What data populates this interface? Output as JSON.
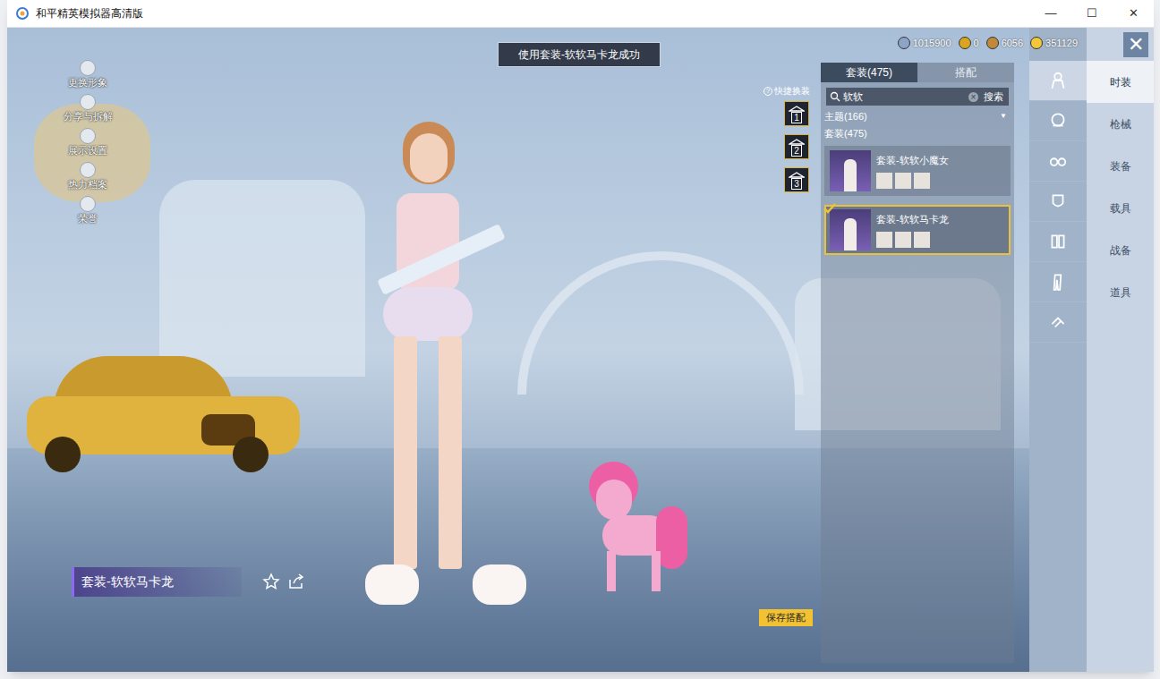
{
  "window": {
    "title": "和平精英模拟器高清版",
    "controls": [
      "—",
      "☐",
      "✕"
    ]
  },
  "toast": "使用套装-软软马卡龙成功",
  "currencies": [
    {
      "value": "1015900",
      "color": "#8fa3c8"
    },
    {
      "value": "0",
      "color": "#d9a520"
    },
    {
      "value": "6056",
      "color": "#c08a3a"
    },
    {
      "value": "351129",
      "color": "#f0c83a"
    }
  ],
  "close": "✕",
  "left_menu": [
    {
      "label": "更换形象"
    },
    {
      "label": "分享与拆解"
    },
    {
      "label": "展示设置"
    },
    {
      "label": "热力档案"
    },
    {
      "label": "荣誉"
    }
  ],
  "quick_change": {
    "help": "?",
    "label": "快捷换装",
    "slots": [
      {
        "label": "1"
      },
      {
        "label": "2"
      },
      {
        "label": "3"
      }
    ]
  },
  "panel": {
    "tabs": [
      {
        "label": "套装(475)",
        "selected": true
      },
      {
        "label": "搭配",
        "selected": false
      }
    ],
    "search": {
      "value": "软软",
      "clear": "×",
      "button": "搜索"
    },
    "filter": {
      "label": "主题(166)",
      "arrow": "▼"
    },
    "section": "套装(475)",
    "items": [
      {
        "name": "套装-软软小魔女",
        "selected": false
      },
      {
        "name": "套装-软软马卡龙",
        "selected": true
      }
    ]
  },
  "icon_column": [
    {
      "selected": true
    },
    {
      "selected": false
    },
    {
      "selected": false
    },
    {
      "selected": false
    },
    {
      "selected": false
    },
    {
      "selected": false
    },
    {
      "selected": false
    }
  ],
  "categories": [
    {
      "label": "时装",
      "selected": true
    },
    {
      "label": "枪械",
      "selected": false
    },
    {
      "label": "装备",
      "selected": false
    },
    {
      "label": "载具",
      "selected": false
    },
    {
      "label": "战备",
      "selected": false
    },
    {
      "label": "道具",
      "selected": false
    }
  ],
  "outfit_label": "套装-软软马卡龙",
  "save_button": "保存搭配"
}
